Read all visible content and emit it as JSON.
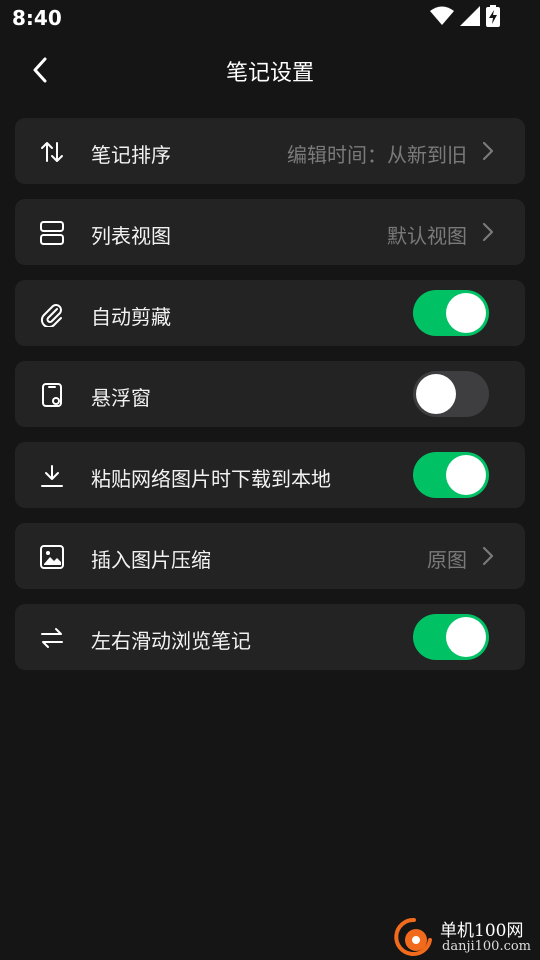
{
  "status_bar": {
    "time": "8:40",
    "icons": [
      "wifi-icon",
      "signal-icon",
      "battery-charging-icon"
    ]
  },
  "header": {
    "title": "笔记设置",
    "back_icon": "chevron-left-icon"
  },
  "settings": [
    {
      "icon": "sort-arrows-icon",
      "label": "笔记排序",
      "value": "编辑时间：从新到旧",
      "control": "chevron"
    },
    {
      "icon": "list-view-icon",
      "label": "列表视图",
      "value": "默认视图",
      "control": "chevron"
    },
    {
      "icon": "paperclip-icon",
      "label": "自动剪藏",
      "control": "toggle",
      "on": true
    },
    {
      "icon": "floating-window-icon",
      "label": "悬浮窗",
      "control": "toggle",
      "on": false
    },
    {
      "icon": "download-icon",
      "label": "粘贴网络图片时下载到本地",
      "control": "toggle",
      "on": true
    },
    {
      "icon": "image-icon",
      "label": "插入图片压缩",
      "value": "原图",
      "control": "chevron"
    },
    {
      "icon": "swap-arrows-icon",
      "label": "左右滑动浏览笔记",
      "control": "toggle",
      "on": true
    }
  ],
  "colors": {
    "background": "#151515",
    "row_background": "#232323",
    "toggle_on": "#00c265",
    "toggle_off": "#3e3e40",
    "value_text": "#7a7a7a",
    "watermark_orange": "#f26b1d"
  },
  "watermark": {
    "title": "单机100网",
    "url": "danji100.com"
  }
}
